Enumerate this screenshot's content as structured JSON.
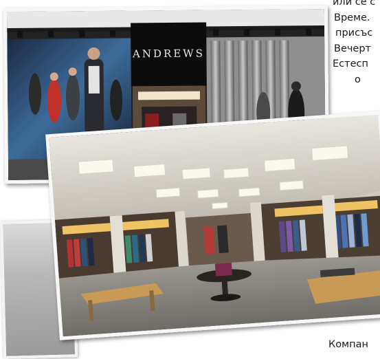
{
  "article": {
    "lines": [
      "или се с",
      "Време.",
      "присъс",
      "Вечерт",
      "Естесп",
      "о"
    ],
    "bottom_line": "Компан"
  },
  "storefront": {
    "sign": "ANDREWS"
  }
}
